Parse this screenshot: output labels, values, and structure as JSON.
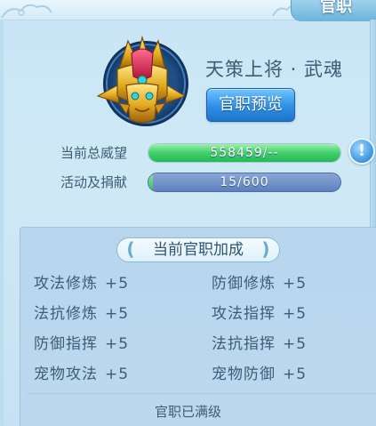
{
  "window": {
    "title": "官职"
  },
  "rank": {
    "name": "天策上将 · 武魂",
    "preview_button": "官职预览",
    "avatar_icon": "warrior-helmet-icon"
  },
  "stats": {
    "prestige_label": "当前总威望",
    "prestige_value": "558459/--",
    "prestige_fill": 1.0,
    "donation_label": "活动及捐献",
    "donation_value": "15/600",
    "donation_fill": 0.025,
    "info_icon_glyph": "!"
  },
  "bonus_panel": {
    "title": "当前官职加成",
    "items": [
      {
        "label": "攻法修炼",
        "value": "+5"
      },
      {
        "label": "防御修炼",
        "value": "+5"
      },
      {
        "label": "法抗修炼",
        "value": "+5"
      },
      {
        "label": "攻法指挥",
        "value": "+5"
      },
      {
        "label": "防御指挥",
        "value": "+5"
      },
      {
        "label": "法抗指挥",
        "value": "+5"
      },
      {
        "label": "宠物攻法",
        "value": "+5"
      },
      {
        "label": "宠物防御",
        "value": "+5"
      }
    ],
    "status_note": "官职已满级"
  },
  "colors": {
    "accent_blue": "#2f8fe6",
    "text_primary": "#3c5d77",
    "bar_green": "#3fcf6a"
  }
}
